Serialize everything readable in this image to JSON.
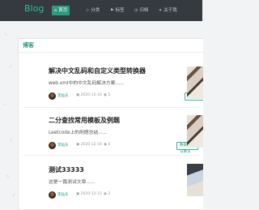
{
  "nav": {
    "brand": "Blog",
    "items": [
      {
        "icon": "⌂",
        "label": "首页",
        "active": true
      },
      {
        "icon": "⊹",
        "label": "分类",
        "active": false
      },
      {
        "icon": "⚑",
        "label": "标签",
        "active": false
      },
      {
        "icon": "◷",
        "label": "归档",
        "active": false
      },
      {
        "icon": "✦",
        "label": "关于我",
        "active": false
      }
    ]
  },
  "panel": {
    "title": "博客"
  },
  "posts": [
    {
      "title": "解决中文乱码和自定义类型转换器",
      "summary": "web.xml中的中文乱码解决方案......",
      "author": "李灿东",
      "date": "2020-12-16",
      "views": "5",
      "tag": "springmvc"
    },
    {
      "title": "二分查找常用模板及例题",
      "summary": "Leetcode上的刷题总结......",
      "author": "李灿东",
      "date": "2020-12-16",
      "views": "4",
      "tag": "数据结构与算法"
    },
    {
      "title": "测试33333",
      "summary": "这是一篇测试文章......",
      "author": "李灿东",
      "date": "2020-12-15",
      "views": "3",
      "tag": ""
    }
  ]
}
